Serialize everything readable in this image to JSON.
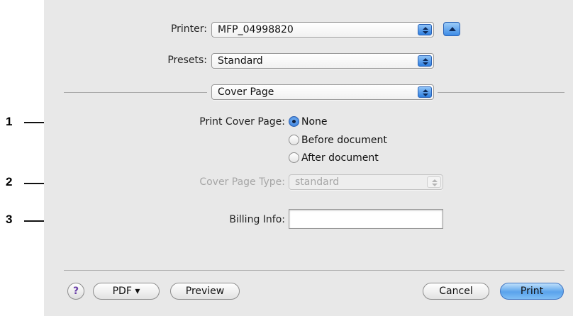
{
  "printer": {
    "label": "Printer:",
    "value": "MFP_04998820"
  },
  "presets": {
    "label": "Presets:",
    "value": "Standard"
  },
  "panel": {
    "value": "Cover Page"
  },
  "print_cover_page": {
    "label": "Print Cover Page:",
    "options": [
      "None",
      "Before document",
      "After document"
    ],
    "selected": "None"
  },
  "cover_page_type": {
    "label": "Cover Page Type:",
    "value": "standard"
  },
  "billing_info": {
    "label": "Billing Info:",
    "value": ""
  },
  "footer": {
    "help": "?",
    "pdf_label": "PDF ▾",
    "preview_label": "Preview",
    "cancel_label": "Cancel",
    "print_label": "Print"
  },
  "callouts": [
    "1",
    "2",
    "3"
  ],
  "colors": {
    "accent": "#3d8be6",
    "dialog_bg": "#e8e8e8"
  }
}
